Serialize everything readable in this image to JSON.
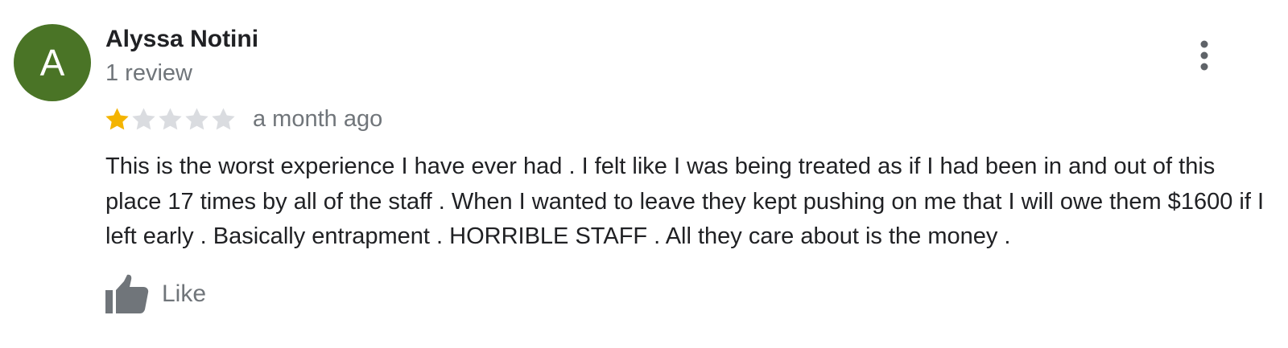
{
  "review": {
    "author": {
      "name": "Alyssa Notini",
      "initial": "A",
      "review_count": "1 review",
      "avatar_color": "#4a7426"
    },
    "rating": {
      "value": 1,
      "max": 5,
      "filled_color": "#f4b400",
      "empty_color": "#dadce0"
    },
    "timestamp": "a month ago",
    "text": "This is the worst experience I have ever had . I felt like I was being treated as if I had been in and out of this place 17 times by all of the staff . When I wanted to leave they kept pushing on me that I will owe them $1600 if I left early . Basically entrapment . HORRIBLE STAFF . All they care about is the money .",
    "actions": {
      "like_label": "Like",
      "like_icon": "thumbs-up-icon",
      "more_icon": "more-vert-icon"
    }
  }
}
